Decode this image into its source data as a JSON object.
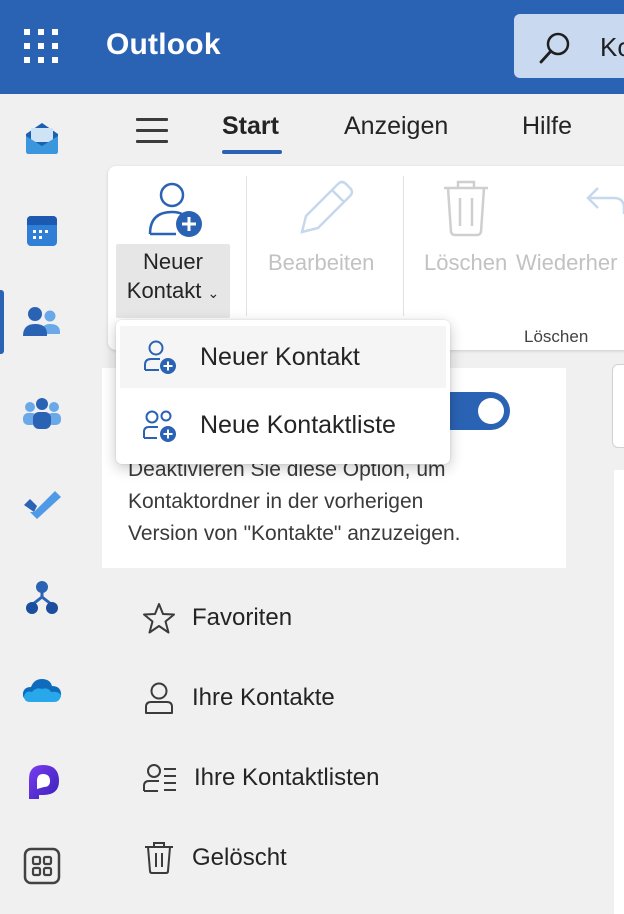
{
  "header": {
    "app_title": "Outlook",
    "search_placeholder_fragment": "Ko",
    "brand_color": "#2b63b4"
  },
  "rail": {
    "items": [
      {
        "name": "mail",
        "icon": "mail-icon"
      },
      {
        "name": "calendar",
        "icon": "calendar-icon"
      },
      {
        "name": "people",
        "icon": "people-icon",
        "active": true
      },
      {
        "name": "groups",
        "icon": "groups-icon"
      },
      {
        "name": "to-do",
        "icon": "todo-check-icon"
      },
      {
        "name": "org",
        "icon": "org-chart-icon"
      },
      {
        "name": "onedrive",
        "icon": "onedrive-cloud-icon"
      },
      {
        "name": "loop",
        "icon": "loop-icon"
      },
      {
        "name": "more-apps",
        "icon": "apps-grid-icon"
      }
    ]
  },
  "tabs": {
    "items": [
      {
        "label": "Start",
        "active": true
      },
      {
        "label": "Anzeigen"
      },
      {
        "label": "Hilfe"
      }
    ]
  },
  "ribbon": {
    "new_contact_line1": "Neuer",
    "new_contact_line2": "Kontakt",
    "edit_label": "Bearbeiten",
    "delete_label": "Löschen",
    "restore_label": "Wiederher",
    "group_label": "Löschen"
  },
  "dropdown": {
    "items": [
      {
        "label": "Neuer Kontakt",
        "icon": "person-add-icon"
      },
      {
        "label": "Neue Kontaktliste",
        "icon": "people-add-icon"
      }
    ]
  },
  "content": {
    "description_line1": "Deaktivieren Sie diese Option, um",
    "description_line2": "Kontaktordner in der vorherigen",
    "description_line3": "Version von \"Kontakte\" anzuzeigen.",
    "toggle_state": "on"
  },
  "nav": {
    "items": [
      {
        "label": "Favoriten",
        "icon": "star-icon"
      },
      {
        "label": "Ihre Kontakte",
        "icon": "person-icon"
      },
      {
        "label": "Ihre Kontaktlisten",
        "icon": "contact-list-icon"
      },
      {
        "label": "Gelöscht",
        "icon": "trash-icon"
      }
    ]
  }
}
